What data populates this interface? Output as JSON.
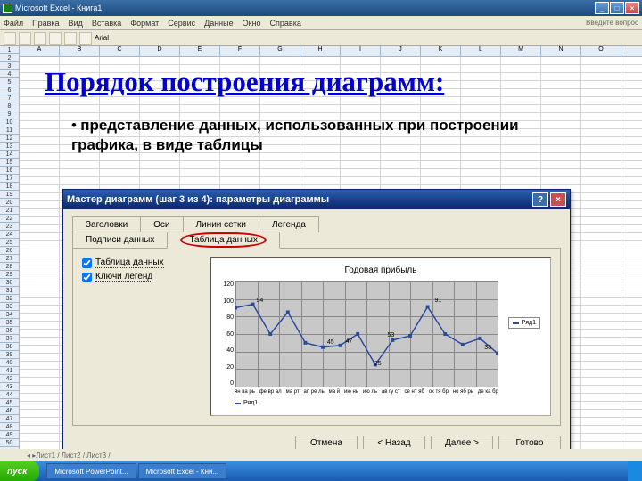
{
  "window": {
    "title": "Microsoft Excel - Книга1"
  },
  "menu": {
    "items": [
      "Файл",
      "Правка",
      "Вид",
      "Вставка",
      "Формат",
      "Сервис",
      "Данные",
      "Окно",
      "Справка"
    ],
    "side": "Введите вопрос"
  },
  "columns": [
    "A",
    "B",
    "C",
    "D",
    "E",
    "F",
    "G",
    "H",
    "I",
    "J",
    "K",
    "L",
    "M",
    "N",
    "O"
  ],
  "slide": {
    "title": "Порядок построения диаграмм:",
    "bullet": "представление данных, использованных при построении графика, в виде таблицы"
  },
  "wizard": {
    "title": "Мастер диаграмм (шаг 3 из 4): параметры диаграммы",
    "tabs_row1": [
      "Заголовки",
      "Оси",
      "Линии сетки",
      "Легенда"
    ],
    "tabs_row2": [
      "Подписи данных",
      "Таблица данных"
    ],
    "checks": {
      "table": "Таблица данных",
      "keys": "Ключи легенд"
    },
    "chart_title": "Годовая прибыль",
    "legend": "Ряд1",
    "footer": "Ряд1",
    "buttons": {
      "cancel": "Отмена",
      "back": "< Назад",
      "next": "Далее >",
      "finish": "Готово"
    }
  },
  "chart_data": {
    "type": "line",
    "title": "Годовая прибыль",
    "categories": [
      "ян ва рь",
      "фе вр ал",
      "ма рт",
      "ап ре ль",
      "ма й",
      "ию нь",
      "ию ль",
      "ав гу ст",
      "се нт яб",
      "ок тя бр",
      "но яб рь",
      "де ка бр"
    ],
    "short_labels": [
      "94",
      "",
      "85",
      "",
      "",
      "45",
      "47",
      "",
      "25",
      "53",
      "",
      "",
      "91",
      "",
      "",
      "38"
    ],
    "values": [
      90,
      94,
      60,
      85,
      50,
      45,
      47,
      60,
      25,
      53,
      58,
      91,
      60,
      48,
      55,
      38
    ],
    "series": [
      {
        "name": "Ряд1",
        "values": [
          90,
          94,
          60,
          85,
          50,
          45,
          47,
          60,
          25,
          53,
          58,
          91,
          60,
          48,
          55,
          38
        ]
      }
    ],
    "ylim": [
      0,
      120
    ],
    "yticks": [
      "0",
      "20",
      "40",
      "60",
      "80",
      "100",
      "120"
    ],
    "xlabel": "",
    "ylabel": ""
  },
  "sheet_tabs": "Лист1 / Лист2 / Лист3 /",
  "taskbar": {
    "start": "пуск",
    "tasks": [
      "",
      "Microsoft PowerPoint...",
      "Microsoft Excel - Кни..."
    ],
    "time": ""
  }
}
